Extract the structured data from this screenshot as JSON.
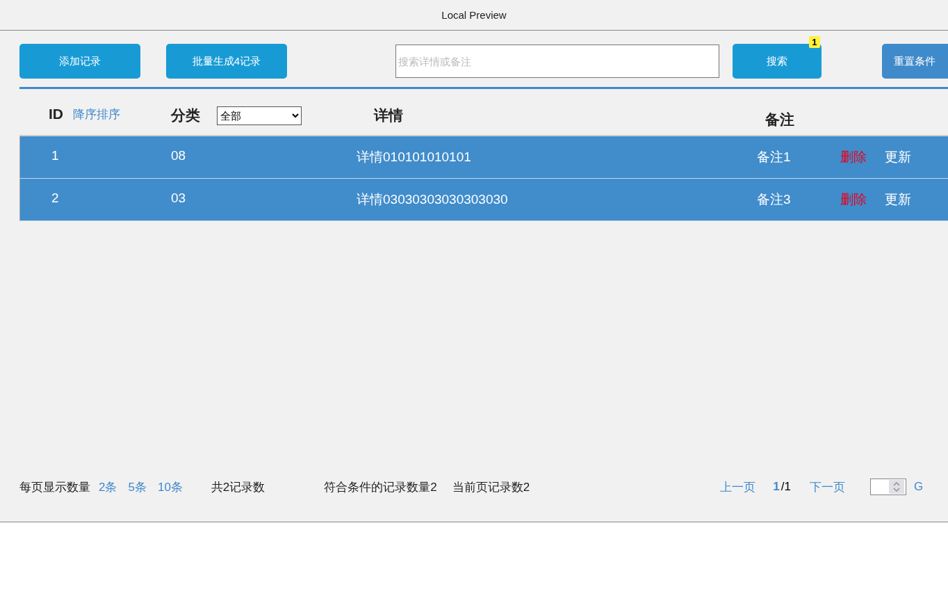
{
  "window": {
    "title": "Local Preview"
  },
  "toolbar": {
    "buttons": [
      "添加记录",
      "批量生成4记录"
    ],
    "search": {
      "placeholder": "搜索详情或备注"
    },
    "search_button": {
      "label": "搜索",
      "badge": "1"
    },
    "reset_button": {
      "label": "重置条件"
    }
  },
  "table": {
    "columns": [
      {
        "kind": "sort",
        "label": "ID",
        "link": "降序排序"
      },
      {
        "kind": "filter",
        "label": "分类",
        "value": "全部"
      },
      {
        "kind": "plain",
        "label": "详情"
      },
      {
        "kind": "plain",
        "label": "备注"
      }
    ],
    "rows": [
      {
        "id": "1",
        "category": "08",
        "detail": "详情010101010101",
        "note": "备注1",
        "delete": "删除",
        "update": "更新"
      },
      {
        "id": "2",
        "category": "03",
        "detail": "详情03030303030303030",
        "note": "备注3",
        "delete": "删除",
        "update": "更新"
      }
    ]
  },
  "footer": {
    "per_page_label": "每页显示数量",
    "per_page_options": [
      "2条",
      "5条",
      "10条"
    ],
    "total": "共2记录数",
    "matched": "符合条件的记录数量2",
    "current_count": "当前页记录数2",
    "prev": "上一页",
    "current_page": "1",
    "total_pages": "/1",
    "next": "下一页",
    "go": "G"
  }
}
